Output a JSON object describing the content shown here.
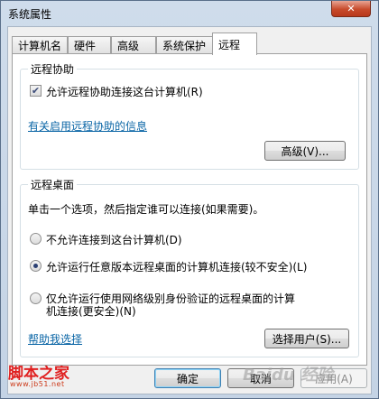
{
  "window": {
    "title": "系统属性",
    "close_glyph": "✕"
  },
  "tabs": [
    {
      "label": "计算机名"
    },
    {
      "label": "硬件"
    },
    {
      "label": "高级"
    },
    {
      "label": "系统保护"
    },
    {
      "label": "远程"
    }
  ],
  "active_tab": "远程",
  "remote_assistance": {
    "legend": "远程协助",
    "allow_checkbox": {
      "label": "允许远程协助连接这台计算机(R)",
      "checked": true,
      "glyph": "✔"
    },
    "info_link": "有关启用远程协助的信息",
    "advanced_button": "高级(V)..."
  },
  "remote_desktop": {
    "legend": "远程桌面",
    "instruction": "单击一个选项，然后指定谁可以连接(如果需要)。",
    "options": [
      {
        "label": "不允许连接到这台计算机(D)",
        "checked": false
      },
      {
        "label": "允许运行任意版本远程桌面的计算机连接(较不安全)(L)",
        "checked": true
      },
      {
        "label_line1": "仅允许运行使用网络级别身份验证的远程桌面的计算",
        "label_line2": "机连接(更安全)(N)",
        "checked": false
      }
    ],
    "help_link": "帮助我选择",
    "select_users_button": "选择用户(S)..."
  },
  "footer": {
    "ok_button": "确定",
    "cancel_button": "取消",
    "apply_button": "应用(A)"
  },
  "watermark": {
    "logo_text": "脚本之家",
    "url_text": "www.jb51.net",
    "baidu_text": "Baidu 经验"
  }
}
